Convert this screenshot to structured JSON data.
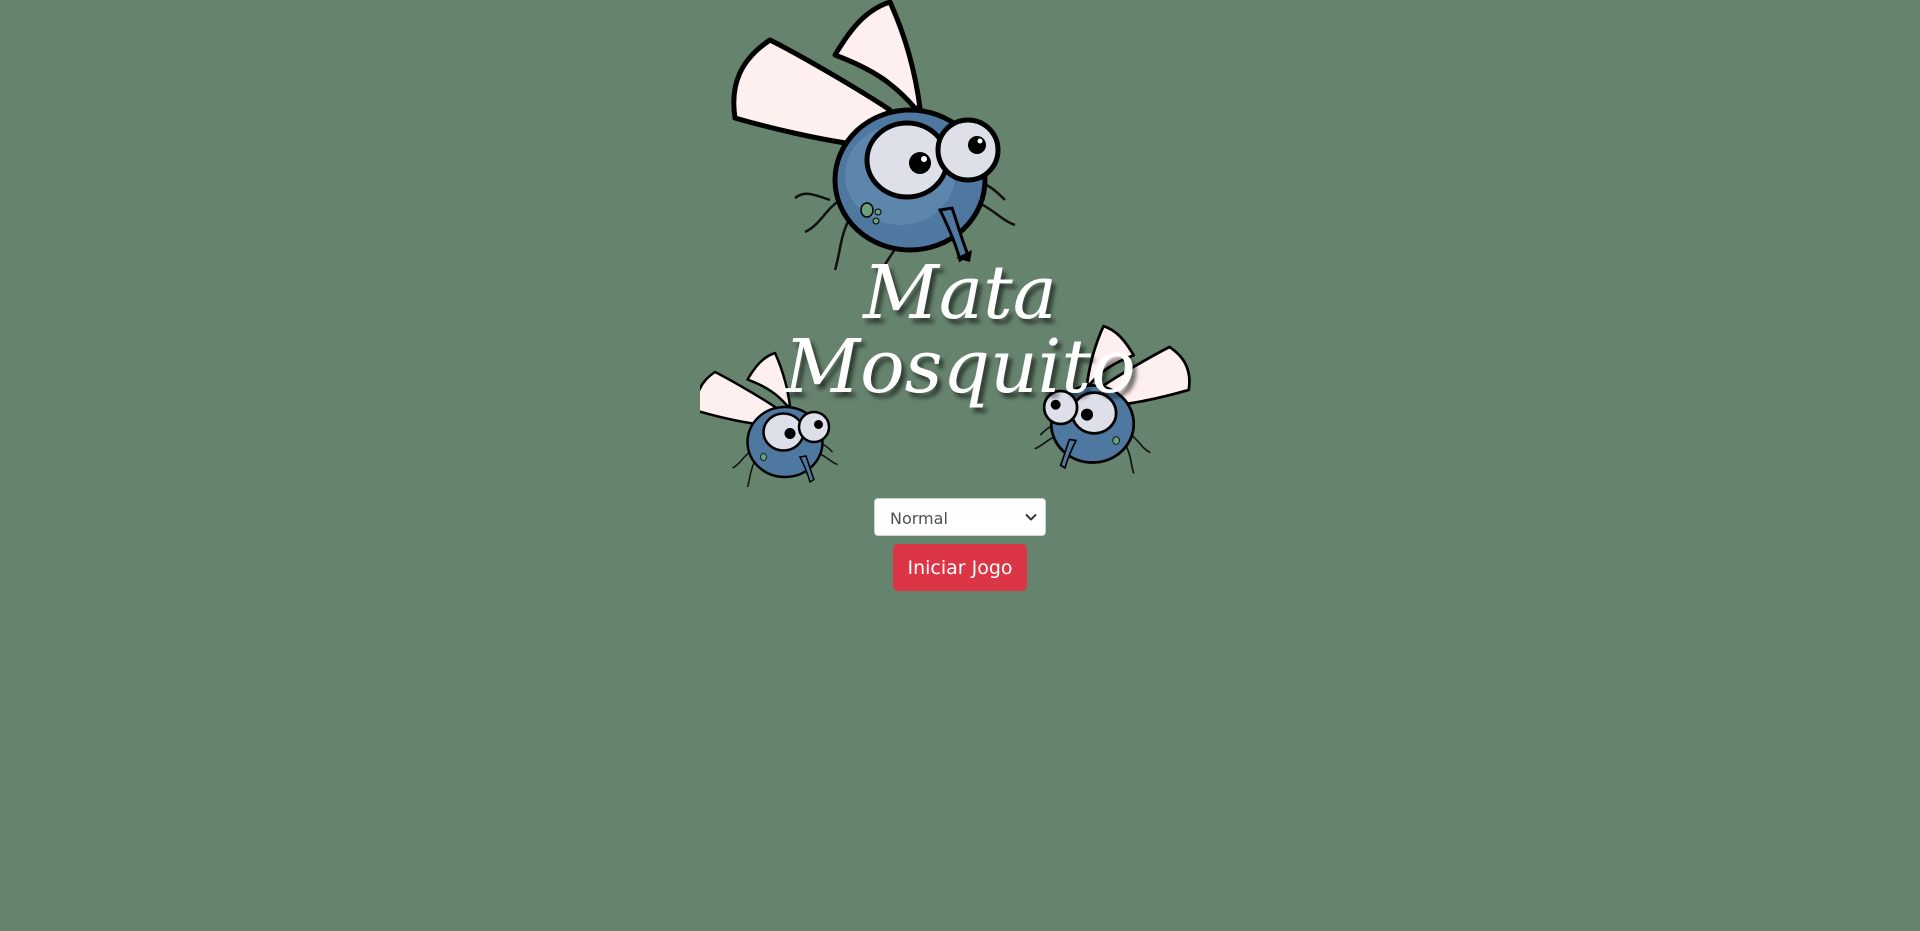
{
  "game": {
    "title_line1": "Mata",
    "title_line2": "Mosquito"
  },
  "difficulty": {
    "selected": "Normal",
    "options": [
      "Normal"
    ]
  },
  "start_button": {
    "label": "Iniciar Jogo"
  },
  "colors": {
    "background": "#66836d",
    "button": "#dc3545",
    "mosquito_body": "#4f78a0",
    "wing": "#fff0f0"
  },
  "icons": {
    "logo": "mosquito-logo",
    "select_arrow": "chevron-down-icon"
  }
}
